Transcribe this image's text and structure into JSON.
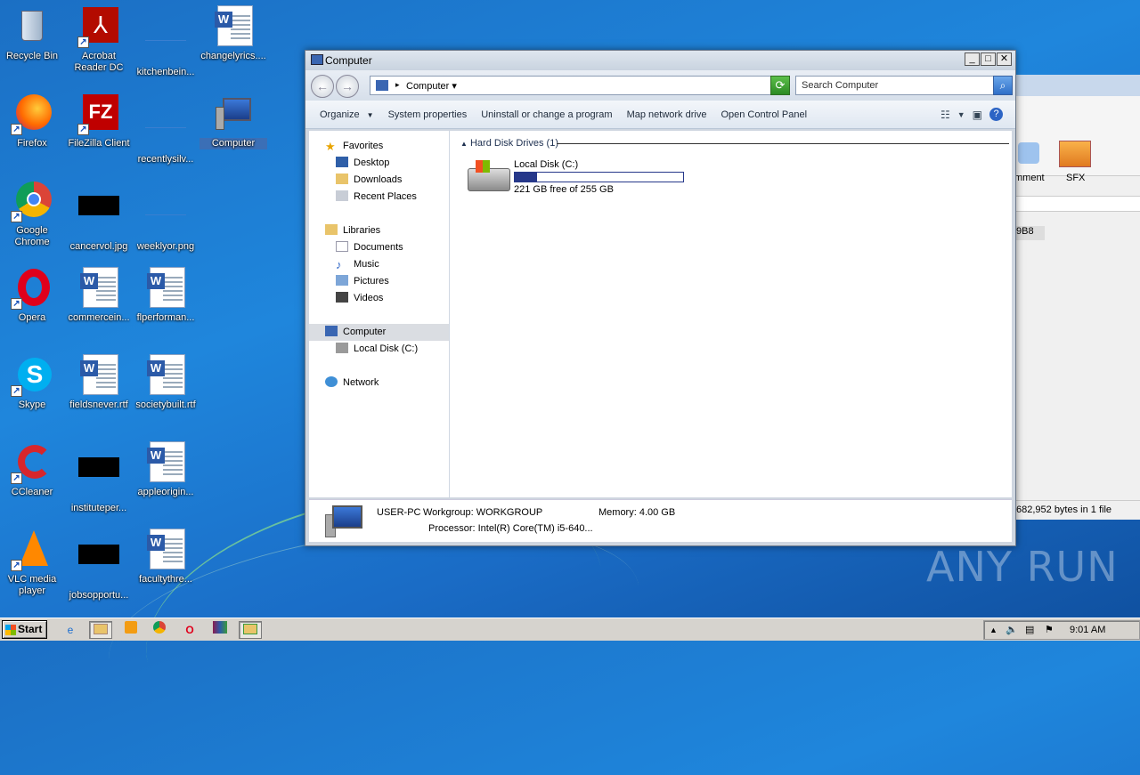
{
  "desktop": {
    "icons": [
      {
        "label": "Recycle Bin"
      },
      {
        "label": "Acrobat Reader DC"
      },
      {
        "label": "kitchenbein..."
      },
      {
        "label": "changelyrics...."
      },
      {
        "label": "Firefox"
      },
      {
        "label": "FileZilla Client"
      },
      {
        "label": "recentlysilv..."
      },
      {
        "label": "Computer"
      },
      {
        "label": "Google Chrome"
      },
      {
        "label": "cancervol.jpg"
      },
      {
        "label": "weeklyor.png"
      },
      {
        "label": "Opera"
      },
      {
        "label": "commercein..."
      },
      {
        "label": "flperforman..."
      },
      {
        "label": "Skype"
      },
      {
        "label": "fieldsnever.rtf"
      },
      {
        "label": "societybuilt.rtf"
      },
      {
        "label": "CCleaner"
      },
      {
        "label": "instituteper..."
      },
      {
        "label": "appleorigin..."
      },
      {
        "label": "VLC media player"
      },
      {
        "label": "jobsopportu..."
      },
      {
        "label": "facultythre..."
      }
    ]
  },
  "bg_window": {
    "toolbar_labels": [
      "mment",
      "SFX"
    ],
    "cell_text": "9B8",
    "status": "682,952 bytes in 1 file"
  },
  "window": {
    "title": "Computer",
    "address_crumb": "Computer",
    "search_placeholder": "Search Computer",
    "commands": {
      "organize": "Organize",
      "system_properties": "System properties",
      "uninstall": "Uninstall or change a program",
      "map_drive": "Map network drive",
      "control_panel": "Open Control Panel"
    },
    "nav": {
      "favorites": "Favorites",
      "desktop": "Desktop",
      "downloads": "Downloads",
      "recent": "Recent Places",
      "libraries": "Libraries",
      "documents": "Documents",
      "music": "Music",
      "pictures": "Pictures",
      "videos": "Videos",
      "computer": "Computer",
      "local_disk": "Local Disk (C:)",
      "network": "Network"
    },
    "group_header": "Hard Disk Drives (1)",
    "drive": {
      "name": "Local Disk (C:)",
      "free_text": "221 GB free of 255 GB",
      "used_fraction": 0.133
    },
    "details": {
      "pc_name": "USER-PC",
      "workgroup": "Workgroup: WORKGROUP",
      "memory": "Memory: 4.00 GB",
      "processor": "Processor: Intel(R) Core(TM) i5-640..."
    }
  },
  "taskbar": {
    "start_label": "Start",
    "clock": "9:01 AM"
  },
  "watermark": "ANY RUN"
}
